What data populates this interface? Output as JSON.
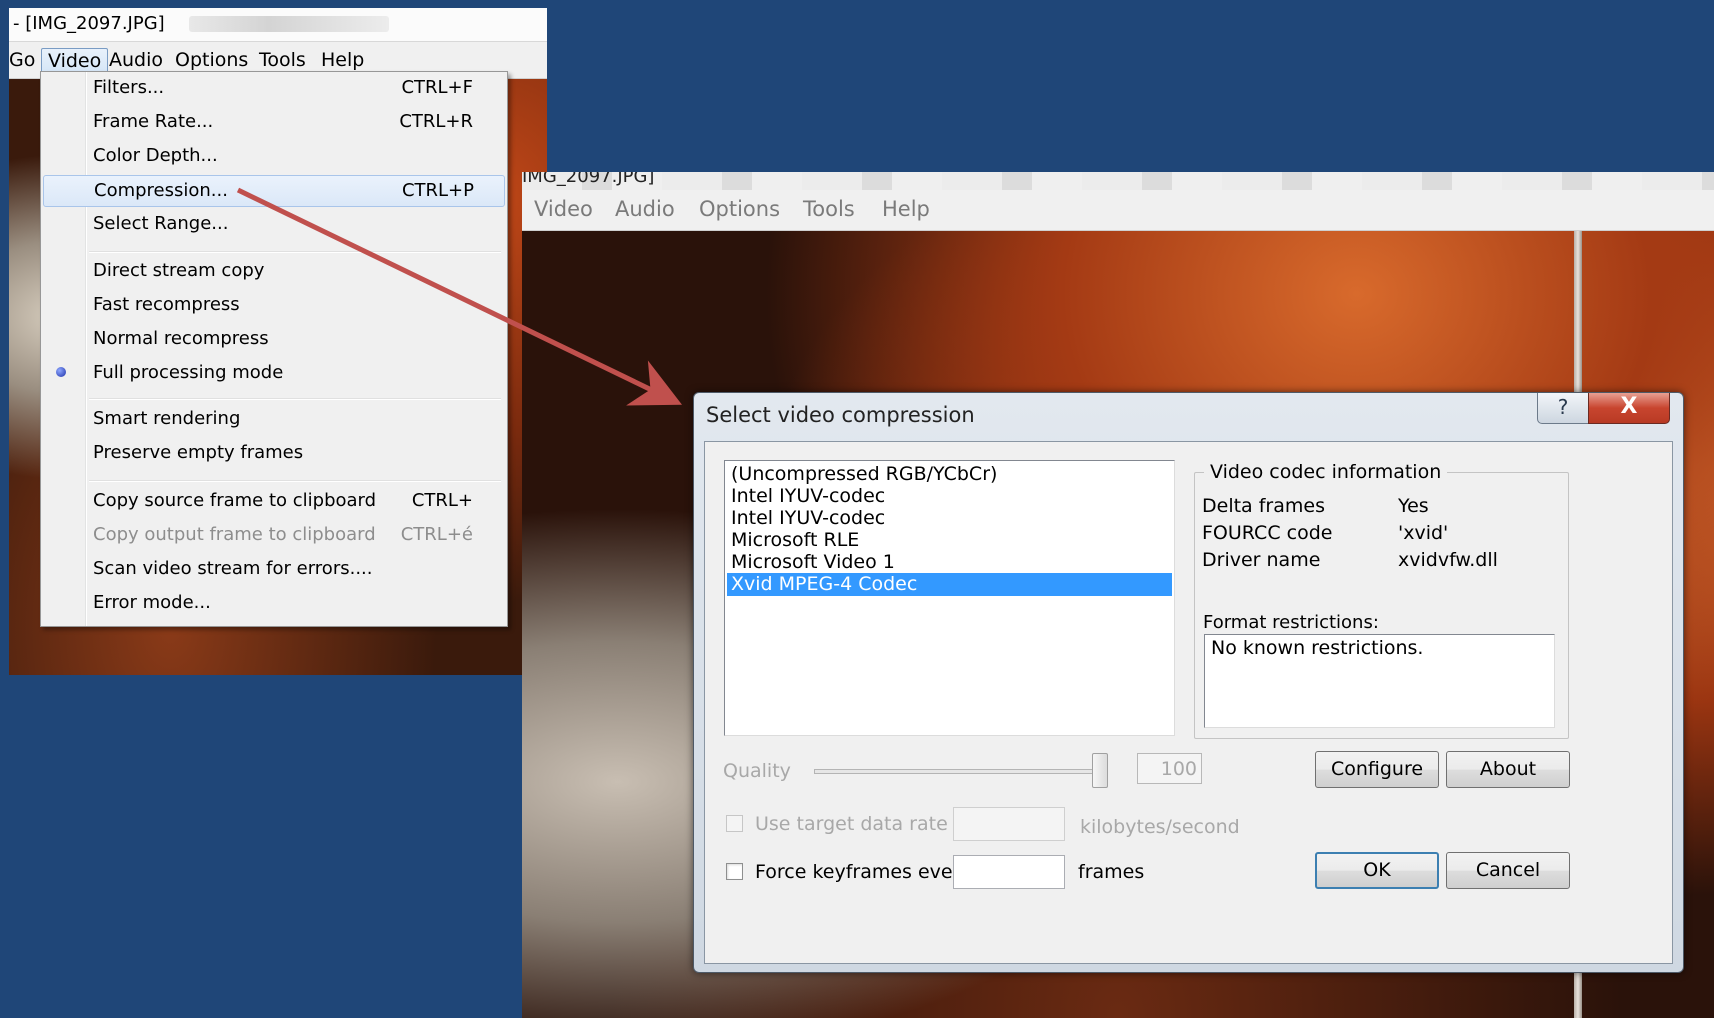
{
  "left_window": {
    "title": "- [IMG_2097.JPG]",
    "menu": [
      "Go",
      "Video",
      "Audio",
      "Options",
      "Tools",
      "Help"
    ],
    "active_menu": "Video"
  },
  "video_menu": {
    "items": [
      {
        "label": "Filters...",
        "shortcut": "CTRL+F"
      },
      {
        "label": "Frame Rate...",
        "shortcut": "CTRL+R"
      },
      {
        "label": "Color Depth...",
        "shortcut": ""
      },
      {
        "label": "Compression...",
        "shortcut": "CTRL+P",
        "highlighted": true
      },
      {
        "label": "Select Range...",
        "shortcut": ""
      },
      {
        "label": "Direct stream copy",
        "shortcut": ""
      },
      {
        "label": "Fast recompress",
        "shortcut": ""
      },
      {
        "label": "Normal recompress",
        "shortcut": ""
      },
      {
        "label": "Full processing mode",
        "shortcut": "",
        "checked": true
      },
      {
        "label": "Smart rendering",
        "shortcut": ""
      },
      {
        "label": "Preserve empty frames",
        "shortcut": ""
      },
      {
        "label": "Copy source frame to clipboard",
        "shortcut": "CTRL+"
      },
      {
        "label": "Copy output frame to clipboard",
        "shortcut": "CTRL+é",
        "disabled": true
      },
      {
        "label": "Scan video stream for errors....",
        "shortcut": ""
      },
      {
        "label": "Error mode...",
        "shortcut": ""
      }
    ]
  },
  "right_window": {
    "title": "IMG_2097.JPG]",
    "menu": [
      "Video",
      "Audio",
      "Options",
      "Tools",
      "Help"
    ]
  },
  "dialog": {
    "title": "Select video compression",
    "help_label": "?",
    "close_label": "X",
    "codecs": [
      "(Uncompressed RGB/YCbCr)",
      "Intel IYUV-codec",
      "Intel IYUV-codec",
      "Microsoft RLE",
      "Microsoft Video 1",
      "Xvid MPEG-4 Codec"
    ],
    "selected_codec": "Xvid MPEG-4 Codec",
    "info": {
      "legend": "Video codec information",
      "delta_frames_label": "Delta frames",
      "delta_frames_value": "Yes",
      "fourcc_label": "FOURCC code",
      "fourcc_value": "'xvid'",
      "driver_label": "Driver name",
      "driver_value": "xvidvfw.dll",
      "format_label": "Format restrictions:",
      "format_value": "No known restrictions."
    },
    "quality_label": "Quality",
    "quality_value": "100",
    "quality_fraction": 1.0,
    "configure_label": "Configure",
    "about_label": "About",
    "target_rate_label": "Use target data rate of",
    "target_rate_unit": "kilobytes/second",
    "target_rate_value": "",
    "keyframes_label": "Force keyframes every",
    "keyframes_unit": "frames",
    "keyframes_value": "",
    "ok_label": "OK",
    "cancel_label": "Cancel"
  },
  "colors": {
    "background": "#1f4678",
    "arrow": "#c0504d",
    "selection": "#3399ff"
  }
}
